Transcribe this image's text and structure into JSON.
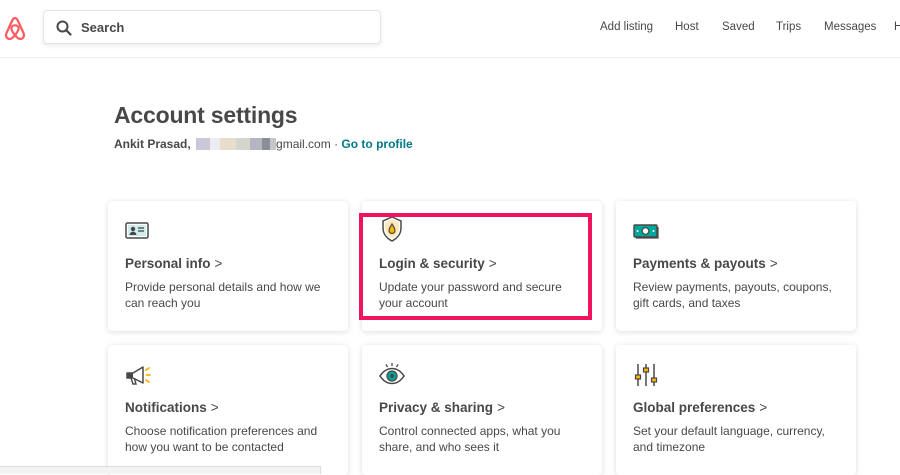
{
  "header": {
    "search_placeholder": "Search",
    "nav": [
      "Add listing",
      "Host",
      "Saved",
      "Trips",
      "Messages",
      "H"
    ]
  },
  "account": {
    "title": "Account settings",
    "name": "Ankit Prasad,",
    "email_suffix": "gmail.com",
    "separator": " · ",
    "profile_link": "Go to profile"
  },
  "cards": [
    {
      "title": "Personal info",
      "chevron": ">",
      "desc": "Provide personal details and how we can reach you",
      "icon": "id-card-icon"
    },
    {
      "title": "Login & security",
      "chevron": ">",
      "desc": "Update your password and secure your account",
      "icon": "shield-icon"
    },
    {
      "title": "Payments & payouts",
      "chevron": ">",
      "desc": "Review payments, payouts, coupons, gift cards, and taxes",
      "icon": "money-icon"
    },
    {
      "title": "Notifications",
      "chevron": ">",
      "desc": "Choose notification preferences and how you want to be contacted",
      "icon": "megaphone-icon"
    },
    {
      "title": "Privacy & sharing",
      "chevron": ">",
      "desc": "Control connected apps, what you share, and who sees it",
      "icon": "eye-icon"
    },
    {
      "title": "Global preferences",
      "chevron": ">",
      "desc": "Set your default language, currency, and timezone",
      "icon": "sliders-icon"
    }
  ],
  "colors": {
    "brand": "#ff5a5f",
    "text": "#484848",
    "link": "#007a87",
    "highlight": "#f0135f",
    "icon_accent": "#00a699",
    "icon_warm": "#ffb400"
  }
}
